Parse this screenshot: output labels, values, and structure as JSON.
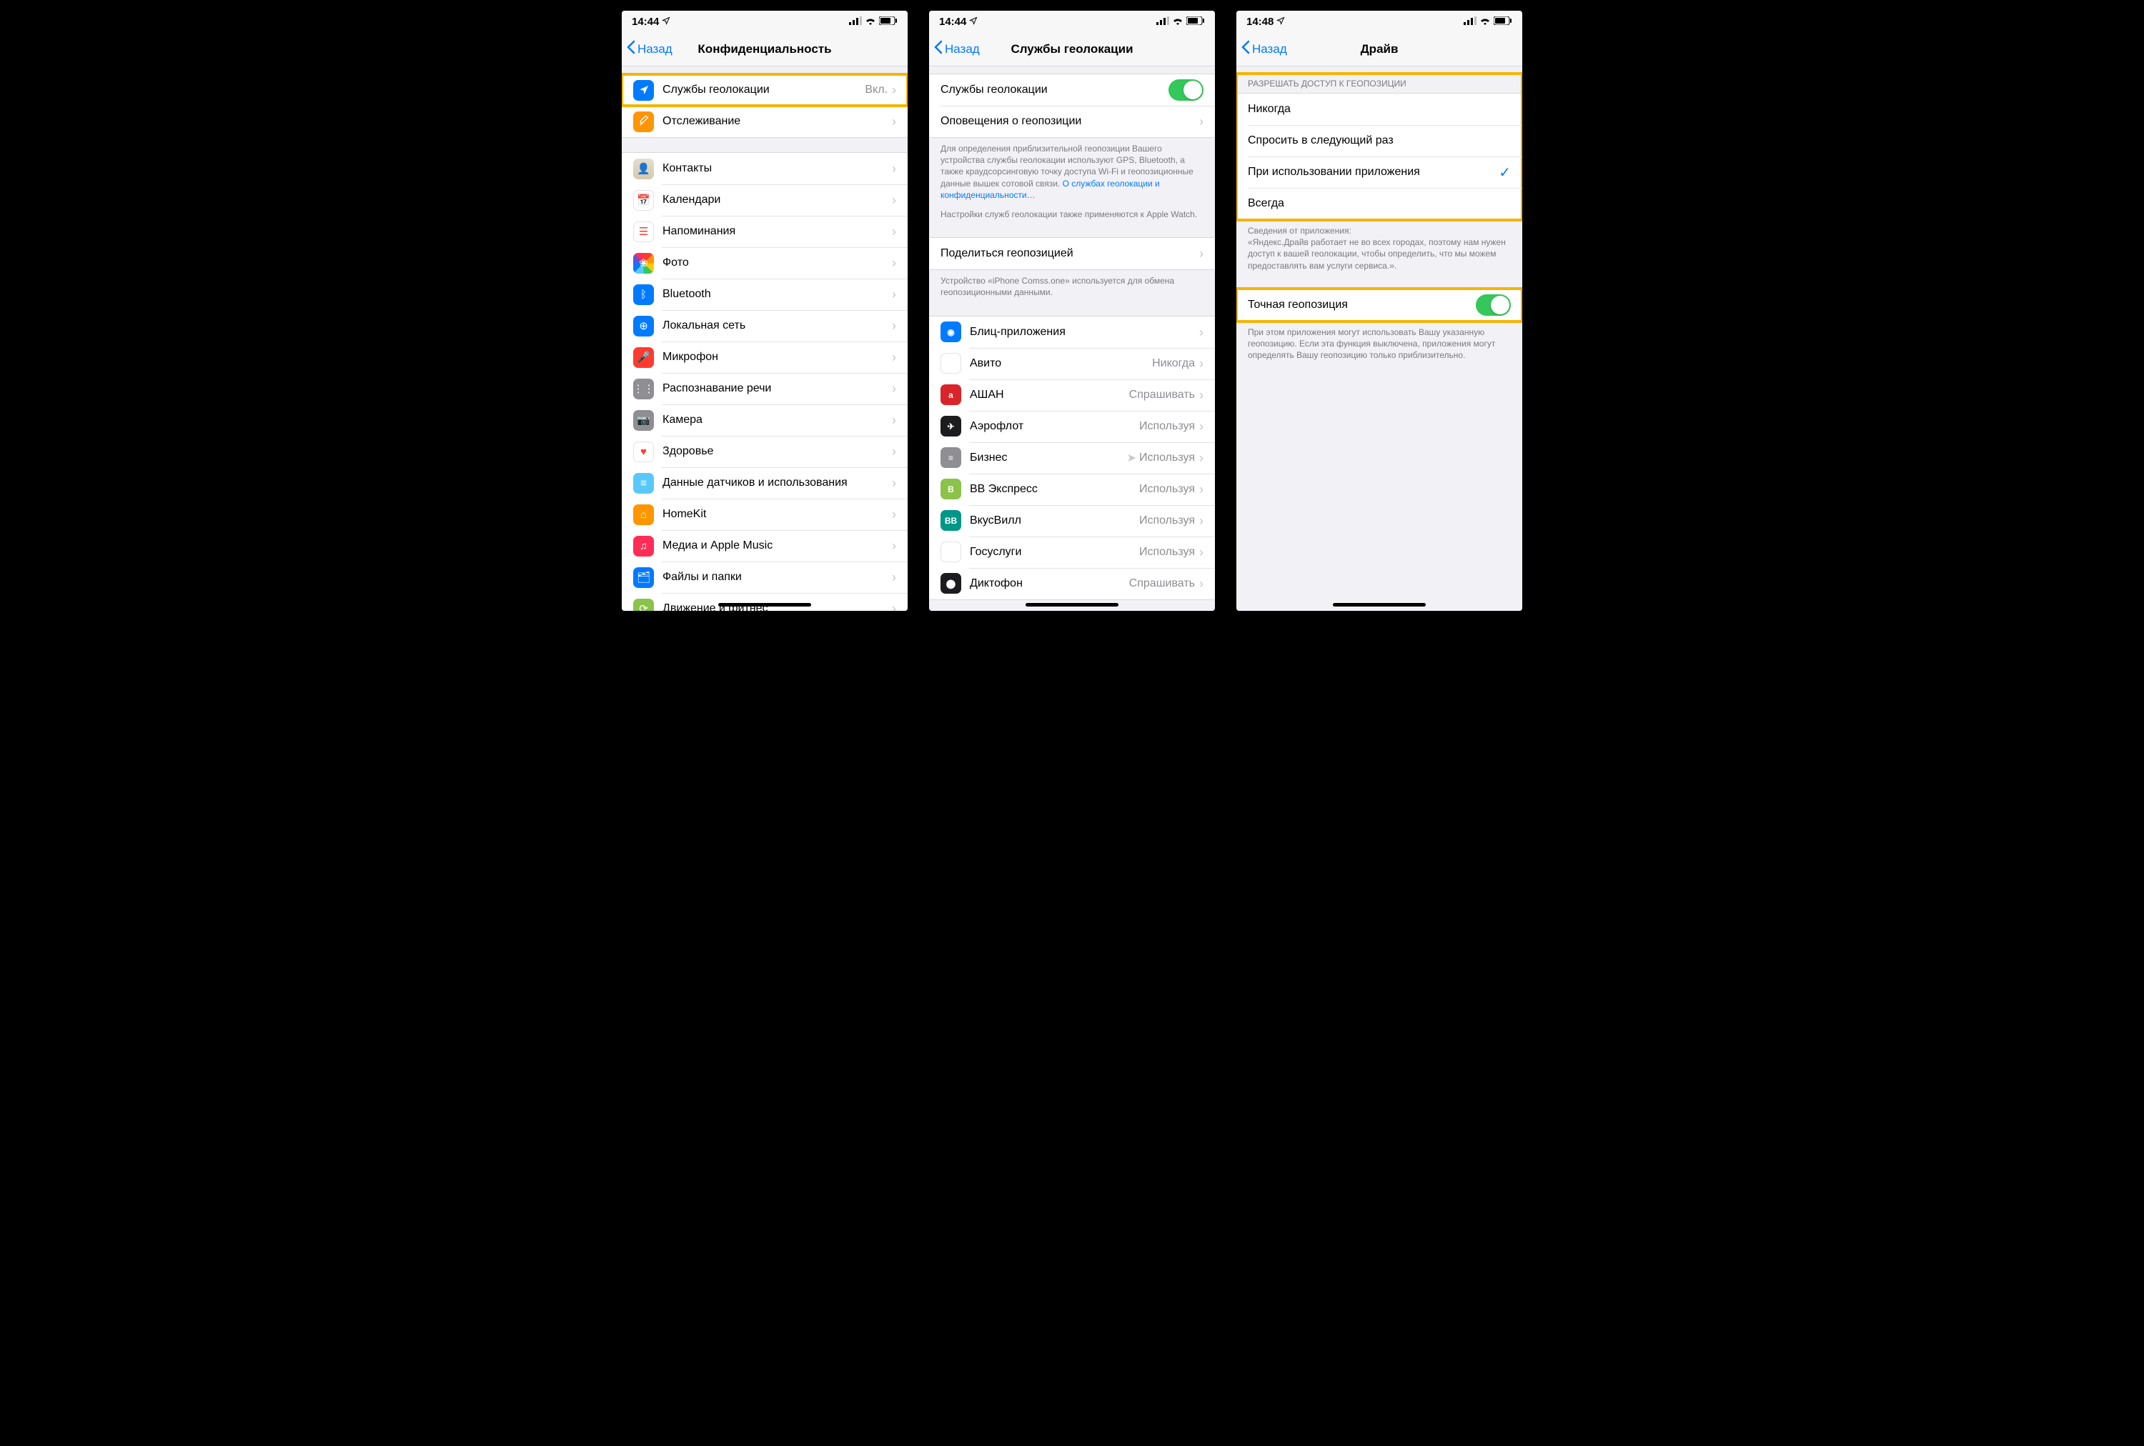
{
  "status": {
    "time1": "14:44",
    "time2": "14:44",
    "time3": "14:48",
    "nav_icon": "➤"
  },
  "back_label": "Назад",
  "screen1": {
    "title": "Конфиденциальность",
    "row_location": {
      "label": "Службы геолокации",
      "value": "Вкл."
    },
    "row_tracking": "Отслеживание",
    "items": [
      "Контакты",
      "Календари",
      "Напоминания",
      "Фото",
      "Bluetooth",
      "Локальная сеть",
      "Микрофон",
      "Распознавание речи",
      "Камера",
      "Здоровье",
      "Данные датчиков и использования",
      "HomeKit",
      "Медиа и Apple Music",
      "Файлы и папки",
      "Движение и фитнес"
    ]
  },
  "screen2": {
    "title": "Службы геолокации",
    "row_location": "Службы геолокации",
    "row_alerts": "Оповещения о геопозиции",
    "footer1a": "Для определения приблизительной геопозиции Вашего устройства службы геолокации используют GPS, Bluetooth, а также краудсорсинговую точку доступа Wi-Fi и геопозиционные данные вышек сотовой связи. ",
    "footer1_link": "О службах геолокации и конфиденциальности…",
    "footer1b": "Настройки служб геолокации также применяются к Apple Watch.",
    "row_share": "Поделиться геопозицией",
    "footer_share": "Устройство «iPhone Comss.one» используется для обмена геопозиционными данными.",
    "apps": [
      {
        "name": "Блиц-приложения",
        "value": ""
      },
      {
        "name": "Авито",
        "value": "Никогда"
      },
      {
        "name": "АШАН",
        "value": "Спрашивать"
      },
      {
        "name": "Аэрофлот",
        "value": "Используя"
      },
      {
        "name": "Бизнес",
        "value": "Используя",
        "recent": true
      },
      {
        "name": "ВВ Экспресс",
        "value": "Используя"
      },
      {
        "name": "ВкусВилл",
        "value": "Используя"
      },
      {
        "name": "Госуслуги",
        "value": "Используя"
      },
      {
        "name": "Диктофон",
        "value": "Спрашивать"
      }
    ]
  },
  "screen3": {
    "title": "Драйв",
    "group_header": "Разрешать доступ к геопозиции",
    "options": [
      {
        "label": "Никогда",
        "selected": false
      },
      {
        "label": "Спросить в следующий раз",
        "selected": false
      },
      {
        "label": "При использовании приложения",
        "selected": true
      },
      {
        "label": "Всегда",
        "selected": false
      }
    ],
    "footer_app_head": "Сведения от приложения:",
    "footer_app_body": "«Яндекс.Драйв работает не во всех городах, поэтому нам нужен доступ к вашей геолокации, чтобы определить, что мы можем предоставлять вам услуги сервиса.».",
    "row_precise": "Точная геопозиция",
    "footer_precise": "При этом приложения могут использовать Вашу указанную геопозицию. Если эта функция выключена, приложения могут определять Вашу геопозицию только приблизительно."
  }
}
